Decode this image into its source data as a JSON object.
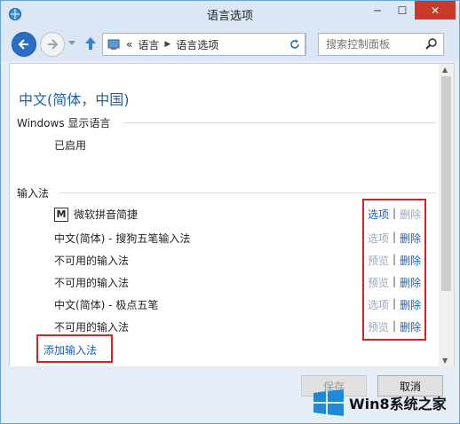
{
  "window": {
    "title": "语言选项",
    "controls": {
      "min": "─",
      "max": "☐",
      "close": "✕"
    }
  },
  "nav": {
    "breadcrumb": [
      "«",
      "语言",
      "语言选项"
    ],
    "search_placeholder": "搜索控制面板",
    "icons": [
      "back-arrow-icon",
      "forward-arrow-icon",
      "history-dropdown-icon",
      "up-arrow-icon",
      "control-panel-icon",
      "refresh-icon",
      "search-icon"
    ]
  },
  "main": {
    "language_title": "中文(简体，中国)",
    "display_language_label": "Windows 显示语言",
    "display_language_status": "已启用",
    "input_section_label": "输入法",
    "input_methods": [
      {
        "name": "微软拼音简捷",
        "has_icon": true,
        "icon_letter": "M",
        "action1": "选项",
        "action1_enabled": true,
        "action2": "删除",
        "action2_enabled": false
      },
      {
        "name": "中文(简体) - 搜狗五笔输入法",
        "has_icon": false,
        "action1": "选项",
        "action1_enabled": false,
        "action2": "删除",
        "action2_enabled": true
      },
      {
        "name": "不可用的输入法",
        "has_icon": false,
        "action1": "预览",
        "action1_enabled": false,
        "action2": "删除",
        "action2_enabled": true
      },
      {
        "name": "不可用的输入法",
        "has_icon": false,
        "action1": "预览",
        "action1_enabled": false,
        "action2": "删除",
        "action2_enabled": true
      },
      {
        "name": "中文(简体) - 极点五笔",
        "has_icon": false,
        "action1": "选项",
        "action1_enabled": false,
        "action2": "删除",
        "action2_enabled": true
      },
      {
        "name": "不可用的输入法",
        "has_icon": false,
        "action1": "预览",
        "action1_enabled": false,
        "action2": "删除",
        "action2_enabled": true
      }
    ],
    "separator": "|",
    "add_input_method": "添加输入法"
  },
  "footer": {
    "save": "保存",
    "cancel": "取消"
  },
  "watermark": {
    "text": "Win8系统之家"
  },
  "colors": {
    "accent_link": "#1a5fb4",
    "disabled_link": "#9aa8bb",
    "highlight_box": "#d42222",
    "heading": "#1e5fb0"
  }
}
